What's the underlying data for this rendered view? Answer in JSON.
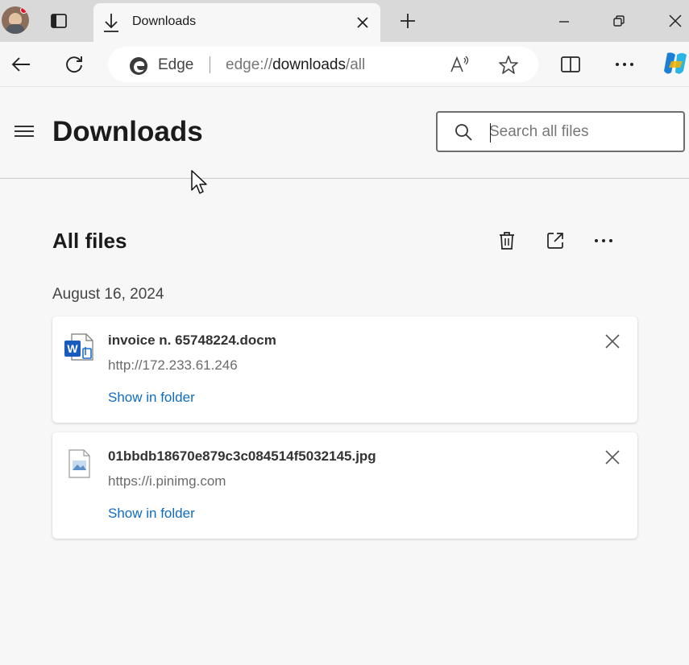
{
  "tab": {
    "title": "Downloads"
  },
  "omnibox": {
    "site_label": "Edge",
    "url_prefix": "edge://",
    "url_host": "downloads",
    "url_path": "/all"
  },
  "page": {
    "title": "Downloads",
    "search_placeholder": "Search all files",
    "section_title": "All files"
  },
  "downloads": [
    {
      "date": "August 16, 2024",
      "items": [
        {
          "filename": "invoice n. 65748224.docm",
          "source": "http://172.233.61.246",
          "action": "Show in folder",
          "icon": "word-doc-icon"
        },
        {
          "filename": "01bbdb18670e879c3c084514f5032145.jpg",
          "source": "https://i.pinimg.com",
          "action": "Show in folder",
          "icon": "image-file-icon"
        }
      ]
    }
  ],
  "colors": {
    "accent_link": "#0f6cbd",
    "page_bg": "#f7f7f7",
    "tabstrip_bg": "#d9d9d9"
  }
}
